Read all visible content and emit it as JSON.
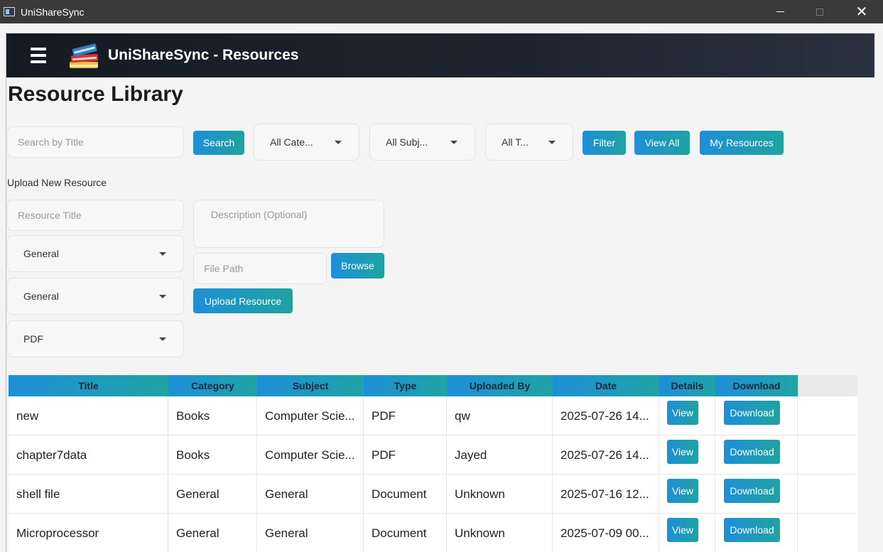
{
  "window": {
    "title": "UniShareSync"
  },
  "header": {
    "title": "UniShareSync - Resources"
  },
  "page": {
    "title": "Resource Library"
  },
  "search": {
    "placeholder": "Search by Title",
    "search_label": "Search",
    "category_filter": "All Cate...",
    "subject_filter": "All Subj...",
    "type_filter": "All T...",
    "filter_label": "Filter",
    "view_all_label": "View All",
    "my_resources_label": "My Resources"
  },
  "upload": {
    "section_label": "Upload New Resource",
    "title_placeholder": "Resource Title",
    "category_value": "General",
    "subject_value": "General",
    "type_value": "PDF",
    "description_placeholder": "Description (Optional)",
    "file_path_placeholder": "File Path",
    "browse_label": "Browse",
    "upload_label": "Upload Resource"
  },
  "table": {
    "headers": [
      "Title",
      "Category",
      "Subject",
      "Type",
      "Uploaded By",
      "Date",
      "Details",
      "Download"
    ],
    "view_label": "View",
    "download_label": "Download",
    "rows": [
      {
        "title": "new",
        "category": "Books",
        "subject": "Computer Scie...",
        "type": "PDF",
        "uploaded_by": "qw",
        "date": "2025-07-26 14..."
      },
      {
        "title": "chapter7data",
        "category": "Books",
        "subject": "Computer Scie...",
        "type": "PDF",
        "uploaded_by": "Jayed",
        "date": "2025-07-26 14..."
      },
      {
        "title": "shell file",
        "category": "General",
        "subject": "General",
        "type": "Document",
        "uploaded_by": "Unknown",
        "date": "2025-07-16 12..."
      },
      {
        "title": "Microprocessor",
        "category": "General",
        "subject": "General",
        "type": "Document",
        "uploaded_by": "Unknown",
        "date": "2025-07-09 00..."
      }
    ]
  }
}
